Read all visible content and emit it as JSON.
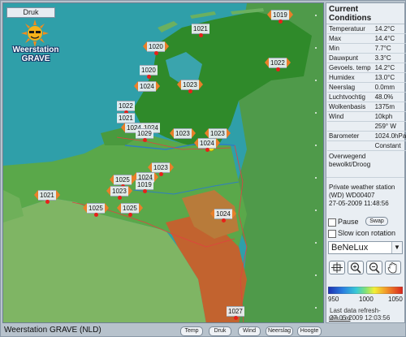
{
  "map": {
    "tab_label": "Druk",
    "logo_line1": "Weerstation",
    "logo_line2": "GRAVE",
    "stations": [
      "1019",
      "1021",
      "1020",
      "1020",
      "1024",
      "1023",
      "1022",
      "1022",
      "1021",
      "1024",
      "1024",
      "1029",
      "1023",
      "1023",
      "1024",
      "1023",
      "1024",
      "1025",
      "1019",
      "1023",
      "1021",
      "1025",
      "1025",
      "1024",
      "1027"
    ]
  },
  "bottom_bar": {
    "title": "Weerstation GRAVE (NLD)",
    "buttons": [
      "Temp",
      "Druk",
      "Wind",
      "Neerslag",
      "Hoogte"
    ]
  },
  "panel": {
    "header": "Current Conditions",
    "rows": [
      {
        "label": "Temperatuur",
        "value": "14.2°C"
      },
      {
        "label": "Max",
        "value": "14.4°C"
      },
      {
        "label": "Min",
        "value": "7.7°C"
      },
      {
        "label": "Dauwpunt",
        "value": "3.3°C"
      },
      {
        "label": "Gevoels. temp",
        "value": "14.2°C"
      },
      {
        "label": "Humidex",
        "value": "13.0°C"
      },
      {
        "label": "Neerslag",
        "value": "0.0mm"
      },
      {
        "label": "Luchtvochtig",
        "value": "48.0%"
      },
      {
        "label": "Wolkenbasis",
        "value": "1375m"
      },
      {
        "label": "Wind",
        "value": "10kph"
      },
      {
        "label": "",
        "value": "259° W"
      },
      {
        "label": "Barometer",
        "value": "1024.0hPa"
      },
      {
        "label": "",
        "value": "Constant"
      }
    ],
    "forecast_line1": "Overwegend",
    "forecast_line2": "bewolkt/Droog",
    "station_line1": "Private weather station",
    "station_line2": "(WD) WD00407",
    "station_line3": "27-05-2009   11:48:56",
    "pause_label": "Pause",
    "swap_label": "Swap",
    "slow_label": "Slow icon rotation",
    "region_value": "BeNeLux",
    "scale_min": "950",
    "scale_mid": "1000",
    "scale_max": "1050",
    "last_refresh_label": "Last data refresh-",
    "last_refresh_value": "27-05-2009   12:03:56",
    "version_link": "MML 1.03"
  }
}
